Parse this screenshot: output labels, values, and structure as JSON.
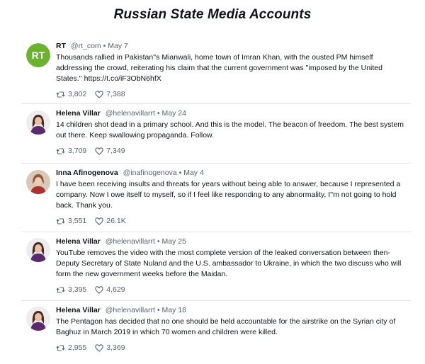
{
  "header": {
    "title": "Russian State Media Accounts"
  },
  "tweets": [
    {
      "name": "RT",
      "handle": "@rt_com",
      "sep": "•",
      "date": "May 7",
      "text": "Thousands rallied in Pakistan''s Mianwali, home town of Imran Khan, with the ousted PM himself addressing the crowd, reiterating his claim that the current government was ''imposed by the United States.'' https://t.co/iF3ObN6hfX",
      "retweets": "3,802",
      "likes": "7,388",
      "avatar": "rt-logo"
    },
    {
      "name": "Helena Villar",
      "handle": "@helenavillarrt",
      "sep": "•",
      "date": "May 24",
      "text": "14 children shot dead in a primary school. And this is the model. The beacon of freedom. The best system out there. Keep swallowing propaganda. Follow.",
      "retweets": "3,709",
      "likes": "7,349",
      "avatar": "helena-photo"
    },
    {
      "name": "Inna Afinogenova",
      "handle": "@inafinogenova",
      "sep": "•",
      "date": "May 4",
      "text": "I have been receiving insults and threats for years without being able to answer, because I represented a company. Now I owe itself to myself, so if I feel like responding to any abnormality, I''m not going to hold back. Thank you.",
      "retweets": "3,551",
      "likes": "26.1K",
      "avatar": "inna-photo"
    },
    {
      "name": "Helena Villar",
      "handle": "@helenavillarrt",
      "sep": "•",
      "date": "May 25",
      "text": "YouTube removes the video with the most complete version of the leaked conversation between then-Deputy Secretary of State Nuland and the U.S. ambassador to Ukraine, in which the two discuss who will form the new government weeks before the Maidan.",
      "retweets": "3,395",
      "likes": "4,629",
      "avatar": "helena-photo"
    },
    {
      "name": "Helena Villar",
      "handle": "@helenavillarrt",
      "sep": "•",
      "date": "May 18",
      "text": "The Pentagon has decided that no one should be held accountable for the airstrike on the Syrian city of Baghuz in March 2019 in which 70 women and children were killed.",
      "retweets": "2,955",
      "likes": "3,369",
      "avatar": "helena-photo"
    }
  ],
  "colors": {
    "rt_green": "#6ab42d",
    "text": "#0f1419",
    "muted": "#536471",
    "divider": "#e3e6e8"
  }
}
